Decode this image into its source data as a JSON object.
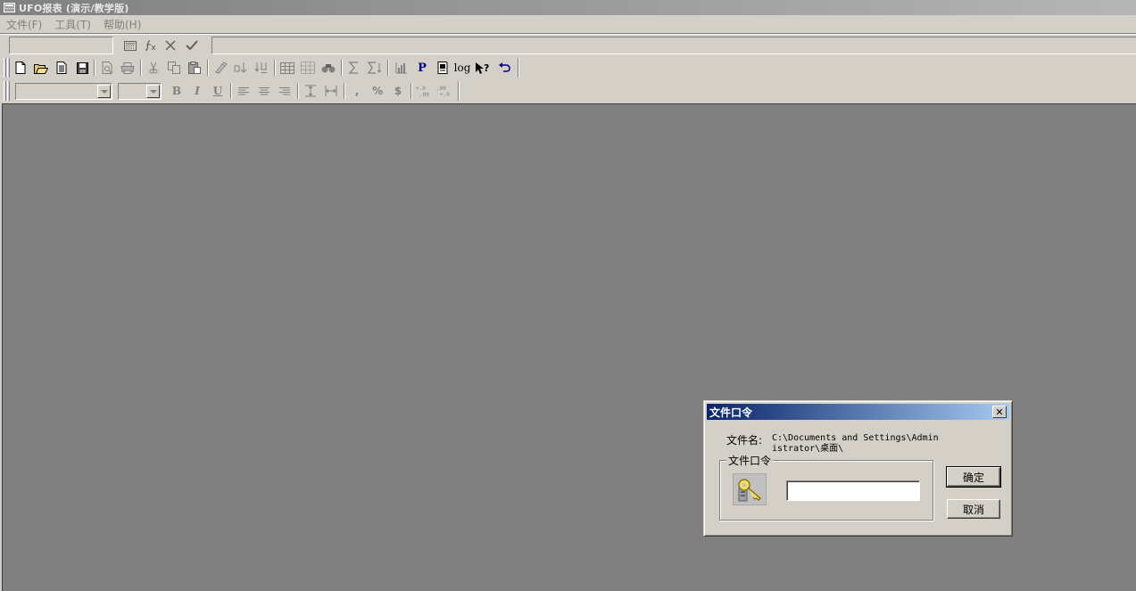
{
  "window": {
    "title": "UFO报表 (演示/教学版)"
  },
  "menu": {
    "items": [
      "文件(F)",
      "工具(T)",
      "帮助(H)"
    ]
  },
  "formula_bar": {
    "cell_name": "",
    "formula": ""
  },
  "toolbar1": {
    "icons": [
      "new-file-icon",
      "open-folder-icon",
      "document-icon",
      "save-icon",
      "print-preview-icon",
      "print-icon",
      "cut-icon",
      "copy-icon",
      "paste-icon",
      "format-painter-icon",
      "sort-asc-icon",
      "sort-desc-icon",
      "grid-icon",
      "dotted-grid-icon",
      "find-icon",
      "sum-icon",
      "sum-down-icon",
      "chart-icon",
      "p-icon",
      "page-icon",
      "log-icon",
      "help-pointer-icon",
      "undo-icon"
    ],
    "p_label": "P",
    "log_label": "log"
  },
  "toolbar2": {
    "font_name": "",
    "font_size": "",
    "bold": "B",
    "italic": "I",
    "underline": "U",
    "comma": ",",
    "percent": "%",
    "currency": "$"
  },
  "dialog": {
    "title": "文件口令",
    "close": "✕",
    "filename_label": "文件名:",
    "filename_value": "C:\\Documents and Settings\\Administrator\\桌面\\",
    "group_label": "文件口令",
    "password_value": "",
    "ok_label": "确定",
    "cancel_label": "取消"
  }
}
